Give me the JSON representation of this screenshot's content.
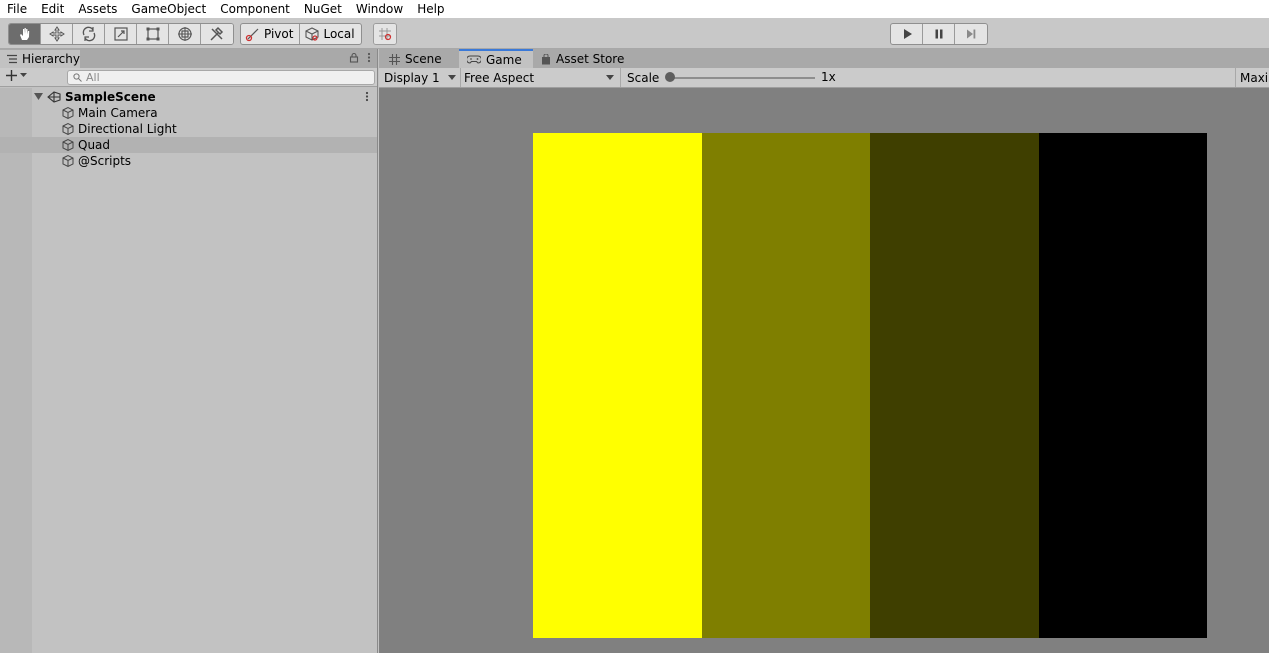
{
  "menu": [
    "File",
    "Edit",
    "Assets",
    "GameObject",
    "Component",
    "NuGet",
    "Window",
    "Help"
  ],
  "toolbar": {
    "tools": [
      "hand-tool-icon",
      "move-tool-icon",
      "rotate-tool-icon",
      "scale-tool-icon",
      "rect-tool-icon",
      "transform-tool-icon",
      "custom-tool-icon"
    ],
    "pivot_label": "Pivot",
    "local_label": "Local",
    "snap_icon": "snap-icon",
    "playback": [
      "play-icon",
      "pause-icon",
      "step-icon"
    ]
  },
  "hierarchy": {
    "tab_label": "Hierarchy",
    "search_placeholder": "All",
    "scene": "SampleScene",
    "items": [
      {
        "label": "Main Camera",
        "selected": false
      },
      {
        "label": "Directional Light",
        "selected": false
      },
      {
        "label": "Quad",
        "selected": true
      },
      {
        "label": "@Scripts",
        "selected": false
      }
    ]
  },
  "game_panel": {
    "tabs": [
      {
        "label": "Scene",
        "icon": "grid-icon",
        "active": false
      },
      {
        "label": "Game",
        "icon": "gamepad-icon",
        "active": true
      },
      {
        "label": "Asset Store",
        "icon": "bag-icon",
        "active": false
      }
    ],
    "display": "Display 1",
    "aspect": "Free Aspect",
    "scale_label": "Scale",
    "scale_value": "1x",
    "maximize_label": "Maxi",
    "scale_slider_fraction": 0.0,
    "render_colors": [
      "#ffff00",
      "#7f7f00",
      "#3f3f00",
      "#000000"
    ]
  }
}
